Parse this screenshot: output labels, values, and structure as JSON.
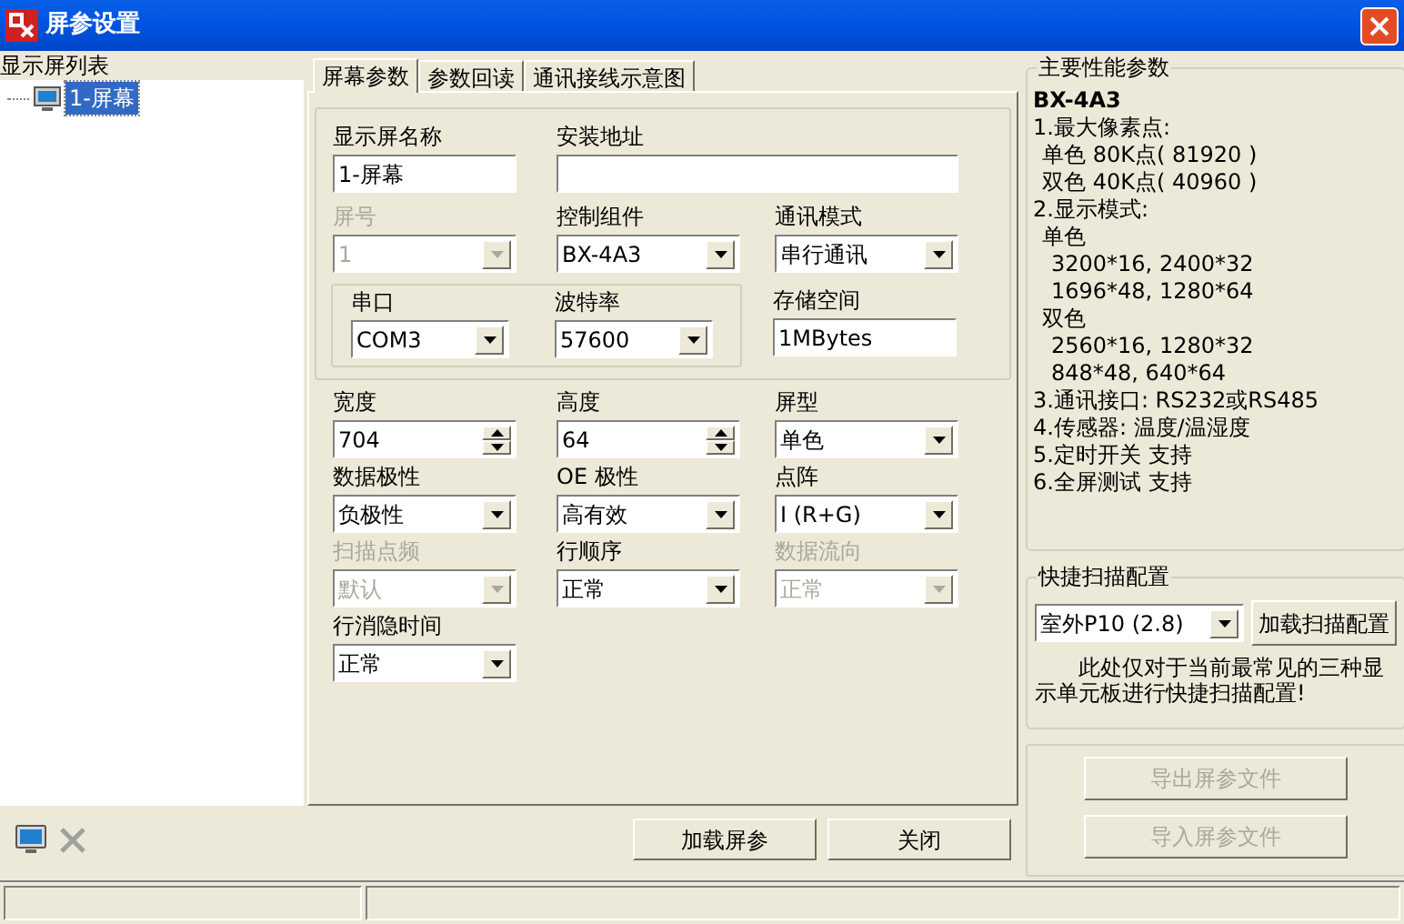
{
  "window": {
    "title": "屏参设置"
  },
  "screen_list": {
    "label": "显示屏列表",
    "items": [
      {
        "label": "1-屏幕",
        "selected": true
      }
    ]
  },
  "tabs": [
    {
      "label": "屏幕参数",
      "selected": true
    },
    {
      "label": "参数回读",
      "selected": false
    },
    {
      "label": "通讯接线示意图",
      "selected": false
    }
  ],
  "group_rows": [
    [
      {
        "kind": "text",
        "label": "显示屏名称",
        "value": "1-屏幕",
        "disabled": false
      },
      {
        "kind": "wide",
        "label": "安装地址",
        "disabled": false
      }
    ],
    [
      {
        "kind": "combo",
        "label": "屏号",
        "value": "1",
        "disabled": true
      },
      {
        "kind": "combo",
        "label": "控制组件",
        "value": "BX-4A3",
        "disabled": false
      },
      {
        "kind": "combo",
        "label": "通讯模式",
        "value": "串行通讯",
        "disabled": false
      }
    ]
  ],
  "serial_group": [
    {
      "kind": "combo",
      "label": "串口",
      "value": "COM3",
      "disabled": false
    },
    {
      "kind": "combo",
      "label": "波特率",
      "value": "57600",
      "disabled": false
    }
  ],
  "storage": {
    "kind": "text",
    "label": "存储空间",
    "value": "1MBytes",
    "disabled": false
  },
  "rows": [
    [
      {
        "kind": "spin",
        "label": "宽度",
        "value": "704",
        "disabled": false
      },
      {
        "kind": "spin",
        "label": "高度",
        "value": "64",
        "disabled": false
      },
      {
        "kind": "combo",
        "label": "屏型",
        "value": "单色",
        "disabled": false
      }
    ],
    [
      {
        "kind": "combo",
        "label": "数据极性",
        "value": "负极性",
        "disabled": false
      },
      {
        "kind": "combo",
        "label": "OE 极性",
        "value": "高有效",
        "disabled": false
      },
      {
        "kind": "combo",
        "label": "点阵",
        "value": "I (R+G)",
        "disabled": false
      }
    ],
    [
      {
        "kind": "combo",
        "label": "扫描点频",
        "value": "默认",
        "disabled": true
      },
      {
        "kind": "combo",
        "label": "行顺序",
        "value": "正常",
        "disabled": false
      },
      {
        "kind": "combo",
        "label": "数据流向",
        "value": "正常",
        "disabled": true
      }
    ],
    [
      {
        "kind": "combo",
        "label": "行消隐时间",
        "value": "正常",
        "disabled": false
      }
    ]
  ],
  "performance": {
    "title": "主要性能参数",
    "model": "BX-4A3",
    "lines": [
      {
        "text": "1.最大像素点:",
        "children": [
          {
            "text": "单色 80K点( 81920 )"
          },
          {
            "text": "双色 40K点( 40960 )"
          }
        ]
      },
      {
        "text": "2.显示模式:",
        "children": [
          {
            "text": "单色",
            "children": [
              {
                "text": "3200*16, 2400*32"
              },
              {
                "text": "1696*48, 1280*64"
              }
            ]
          },
          {
            "text": "双色",
            "children": [
              {
                "text": "2560*16, 1280*32"
              },
              {
                "text": "848*48, 640*64"
              }
            ]
          }
        ]
      },
      {
        "text": "3.通讯接口: RS232或RS485"
      },
      {
        "text": "4.传感器: 温度/温湿度"
      },
      {
        "text": "5.定时开关 支持"
      },
      {
        "text": "6.全屏测试 支持"
      }
    ]
  },
  "quick_scan": {
    "title": "快捷扫描配置",
    "value": "室外P10 (2.8)",
    "button": "加载扫描配置",
    "note": "此处仅对于当前最常见的三种显示单元板进行快捷扫描配置!"
  },
  "file_buttons": [
    {
      "label": "导出屏参文件",
      "disabled": true
    },
    {
      "label": "导入屏参文件",
      "disabled": true
    }
  ],
  "toolbar": [
    {
      "kind": "add",
      "disabled": false
    },
    {
      "kind": "delete",
      "disabled": true
    }
  ],
  "buttons": [
    {
      "label": "加载屏参"
    },
    {
      "label": "关闭"
    }
  ]
}
